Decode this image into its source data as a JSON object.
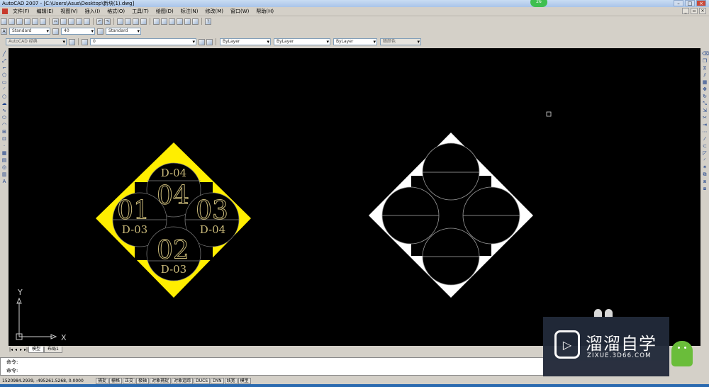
{
  "window": {
    "title": "AutoCAD 2007 - [C:\\Users\\Asus\\Desktop\\新块(1).dwg]",
    "badge": "26"
  },
  "menu": [
    "文件(F)",
    "编辑(E)",
    "视图(V)",
    "插入(I)",
    "格式(O)",
    "工具(T)",
    "绘图(D)",
    "标注(N)",
    "修改(M)",
    "窗口(W)",
    "帮助(H)"
  ],
  "styles": {
    "text_style": "Standard",
    "dim_scale": "40",
    "table_style": "Standard"
  },
  "layers": {
    "workspace": "AutoCAD 经典",
    "layer_name": "0",
    "color": "ByLayer",
    "linetype": "ByLayer",
    "lineweight": "ByLayer",
    "plotstyle": "随颜色"
  },
  "drawing": {
    "colors": {
      "background": "#000000",
      "yellow_fill": "#ffee00",
      "text_color": "#c8b878",
      "white": "#ffffff"
    },
    "left_block": {
      "top_circle": "04",
      "top_label": "D-04",
      "left_circle": "01",
      "left_label": "D-03",
      "right_circle": "03",
      "right_label": "D-04",
      "bottom_circle": "02",
      "bottom_label": "D-03"
    }
  },
  "ucs": {
    "y": "Y",
    "x": "X"
  },
  "layout_tabs": [
    "模型",
    "布局1"
  ],
  "command": {
    "line1": "命令:",
    "line2": "命令:"
  },
  "status": {
    "coords": "1520984.2939, -495261.5268, 0.0000",
    "buttons": [
      "捕捉",
      "栅格",
      "正交",
      "极轴",
      "对象捕捉",
      "对象追踪",
      "DUCS",
      "DYN",
      "线宽",
      "模型"
    ]
  },
  "watermark": {
    "brand": "溜溜自学",
    "url": "ZIXUE.3D66.COM"
  }
}
